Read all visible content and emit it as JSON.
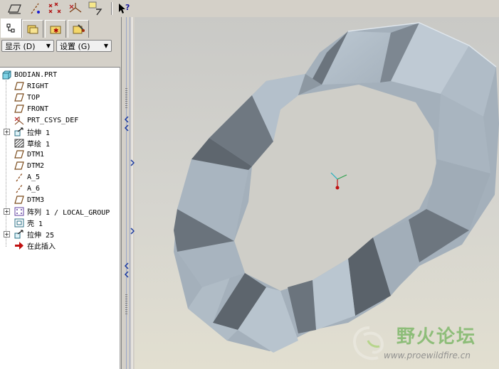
{
  "toolbar": {
    "buttons": [
      {
        "name": "plane-display-icon"
      },
      {
        "name": "axis-display-icon"
      },
      {
        "name": "point-display-icon"
      },
      {
        "name": "csys-display-icon"
      },
      {
        "name": "annotation-display-icon"
      },
      {
        "name": "whats-this-help-icon"
      }
    ]
  },
  "nav_tabs": [
    {
      "name": "model-tree-tab-icon",
      "active": true
    },
    {
      "name": "folder-browser-tab-icon",
      "active": false
    },
    {
      "name": "favorites-tab-icon",
      "active": false
    },
    {
      "name": "connections-tab-icon",
      "active": false
    }
  ],
  "menus": {
    "display_label": "显示 (D)",
    "settings_label": "设置 (G)"
  },
  "tree": {
    "items": [
      {
        "label": "BODIAN.PRT",
        "icon": "part-icon"
      },
      {
        "label": "RIGHT",
        "icon": "datum-plane-icon"
      },
      {
        "label": "TOP",
        "icon": "datum-plane-icon"
      },
      {
        "label": "FRONT",
        "icon": "datum-plane-icon"
      },
      {
        "label": "PRT_CSYS_DEF",
        "icon": "csys-icon"
      },
      {
        "label": "拉伸 1",
        "icon": "extrude-icon"
      },
      {
        "label": "草绘 1",
        "icon": "sketch-icon"
      },
      {
        "label": "DTM1",
        "icon": "datum-plane-icon"
      },
      {
        "label": "DTM2",
        "icon": "datum-plane-icon"
      },
      {
        "label": "A_5",
        "icon": "datum-axis-icon"
      },
      {
        "label": "A_6",
        "icon": "datum-axis-icon"
      },
      {
        "label": "DTM3",
        "icon": "datum-plane-icon"
      },
      {
        "label": "阵列 1 / LOCAL_GROUP",
        "icon": "pattern-icon"
      },
      {
        "label": "壳 1",
        "icon": "shell-icon"
      },
      {
        "label": "拉伸 25",
        "icon": "extrude-icon"
      },
      {
        "label": "在此插入",
        "icon": "insert-here-arrow-icon"
      }
    ]
  },
  "watermark": {
    "title": "野火论坛",
    "url": "www.proewildfire.cn"
  },
  "colors": {
    "viewport_top": "#c9c9c6",
    "viewport_bottom": "#e2dfd0",
    "model_light": "#b4c1cc",
    "model_mid": "#9aa6b2",
    "model_dark": "#6b747d",
    "model_darkest": "#4f565d",
    "watermark_green": "#7fb86a"
  }
}
